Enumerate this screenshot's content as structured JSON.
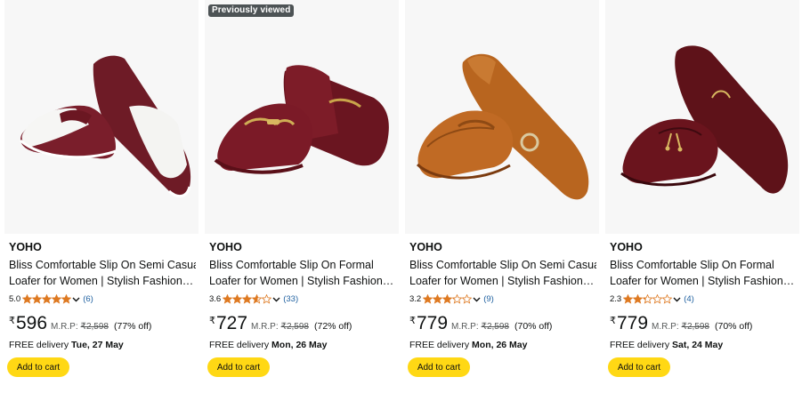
{
  "badge": "Previously viewed",
  "add_to_cart_label": "Add to cart",
  "currency_symbol": "₹",
  "mrp_label": "M.R.P:",
  "delivery_prefix": "FREE delivery",
  "colors": {
    "button": "#ffd814",
    "star": "#de7921",
    "link": "#2162a1"
  },
  "products": [
    {
      "brand": "YOHO",
      "title_line1": "Bliss Comfortable Slip On Semi Casual",
      "title_line2": "Loafer for Women | Stylish Fashion…",
      "rating": 5.0,
      "rating_text": "5.0",
      "reviews": "(6)",
      "price": "596",
      "mrp": "₹2,598",
      "discount": "(77% off)",
      "delivery_date": "Tue, 27 May",
      "image": "maroon-white-penny-loafer"
    },
    {
      "brand": "YOHO",
      "title_line1": "Bliss Comfortable Slip On Formal",
      "title_line2": "Loafer for Women | Stylish Fashion…",
      "rating": 3.6,
      "rating_text": "3.6",
      "reviews": "(33)",
      "price": "727",
      "mrp": "₹2,598",
      "discount": "(72% off)",
      "delivery_date": "Mon, 26 May",
      "image": "maroon-horsebit-mule"
    },
    {
      "brand": "YOHO",
      "title_line1": "Bliss Comfortable Slip On Semi Casual",
      "title_line2": "Loafer for Women | Stylish Fashion…",
      "rating": 3.2,
      "rating_text": "3.2",
      "reviews": "(9)",
      "price": "779",
      "mrp": "₹2,598",
      "discount": "(70% off)",
      "delivery_date": "Mon, 26 May",
      "image": "tan-croc-ring-loafer"
    },
    {
      "brand": "YOHO",
      "title_line1": "Bliss Comfortable Slip On Formal",
      "title_line2": "Loafer for Women | Stylish Fashion…",
      "rating": 2.3,
      "rating_text": "2.3",
      "reviews": "(4)",
      "price": "779",
      "mrp": "₹2,598",
      "discount": "(70% off)",
      "delivery_date": "Sat, 24 May",
      "image": "burgundy-croc-tassel-loafer"
    }
  ]
}
